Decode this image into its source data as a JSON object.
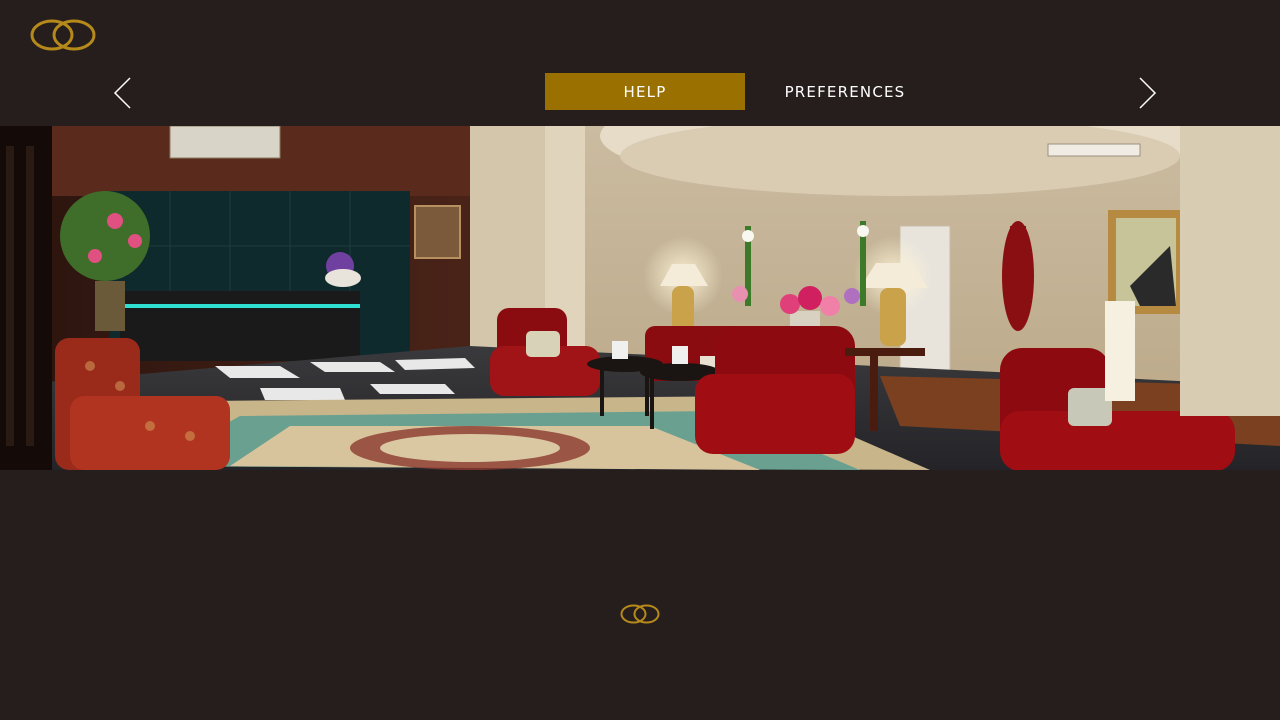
{
  "app": {
    "brand": "Hotel lobby app",
    "accent_color": "#9a7100",
    "logo_color": "#b58a1a",
    "background_color": "#261e1d"
  },
  "header": {
    "prev_icon": "chevron-left-icon",
    "next_icon": "chevron-right-icon",
    "tabs": [
      {
        "label": "HELP",
        "active": true
      },
      {
        "label": "PREFERENCES",
        "active": false
      }
    ]
  },
  "hero": {
    "image": "hotel-lobby-photo"
  }
}
